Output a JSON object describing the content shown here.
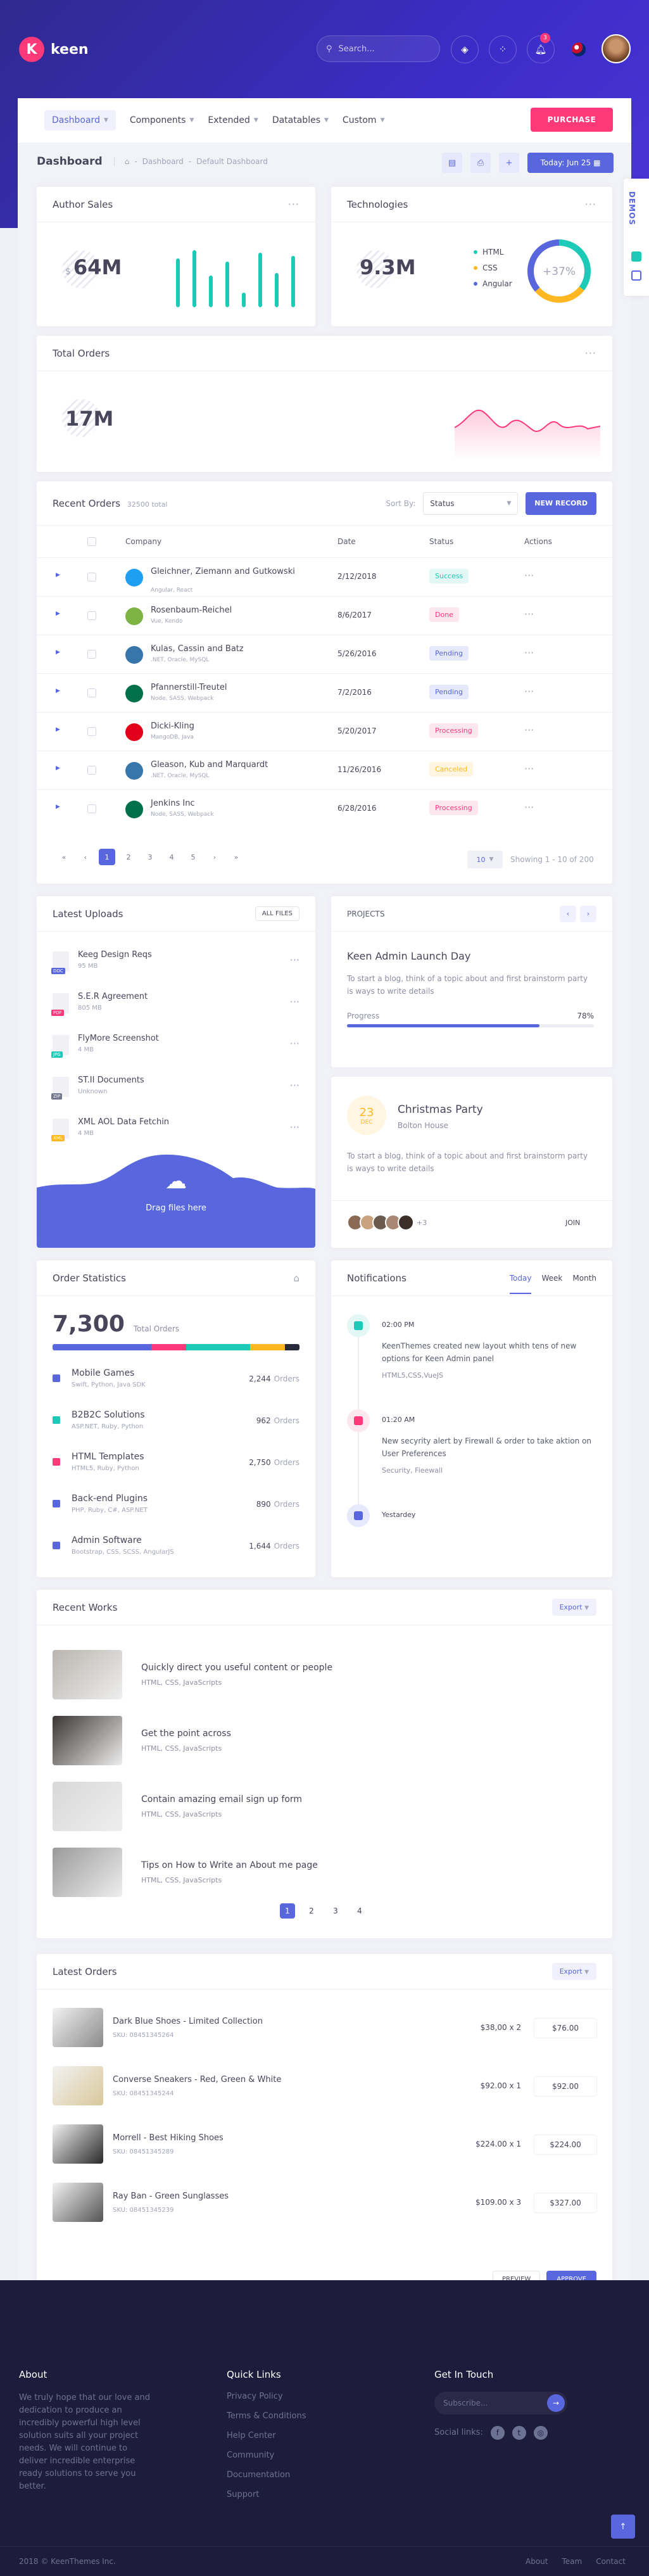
{
  "brand": {
    "name": "keen",
    "letter": "K"
  },
  "header": {
    "search_placeholder": "Search...",
    "notif_count": "3"
  },
  "menu": {
    "items": [
      "Dashboard",
      "Components",
      "Extended",
      "Datatables",
      "Custom"
    ],
    "purchase": "PURCHASE"
  },
  "subheader": {
    "title": "Dashboard",
    "crumbs": [
      "Dashboard",
      "Default Dashboard"
    ],
    "today": "Today: Jun 25"
  },
  "demos": "DEMOS",
  "author_sales": {
    "title": "Author Sales",
    "currency": "$",
    "value": "64M",
    "bars": [
      0.85,
      1.0,
      0.55,
      0.8,
      0.25,
      0.95,
      0.6,
      0.9
    ]
  },
  "technologies": {
    "title": "Technologies",
    "value": "9.3M",
    "legend": [
      {
        "label": "HTML",
        "color": "#1dc9b7"
      },
      {
        "label": "CSS",
        "color": "#ffb822"
      },
      {
        "label": "Angular",
        "color": "#5867dd"
      }
    ],
    "center": "+37%"
  },
  "total_orders": {
    "title": "Total Orders",
    "value": "17M"
  },
  "recent_orders": {
    "title": "Recent Orders",
    "total": "32500 total",
    "sort_label": "Sort By:",
    "sort_value": "Status",
    "new_record": "NEW RECORD",
    "headers": [
      "Company",
      "Date",
      "Status",
      "Actions"
    ],
    "rows": [
      {
        "company": "Gleichner, Ziemann and Gutkowski",
        "tech": "Angular, React",
        "date": "2/12/2018",
        "status": "Success",
        "kind": "success",
        "logo": "#1e9ff2"
      },
      {
        "company": "Rosenbaum-Reichel",
        "tech": "Vue, Kendo",
        "date": "8/6/2017",
        "status": "Done",
        "kind": "danger",
        "logo": "#7cb342"
      },
      {
        "company": "Kulas, Cassin and Batz",
        "tech": ".NET, Oracle, MySQL",
        "date": "5/26/2016",
        "status": "Pending",
        "kind": "info",
        "logo": "#3776ab"
      },
      {
        "company": "Pfannerstill-Treutel",
        "tech": "Node, SASS, Webpack",
        "date": "7/2/2016",
        "status": "Pending",
        "kind": "info",
        "logo": "#00704a"
      },
      {
        "company": "Dicki-Kling",
        "tech": "MangoDB, Java",
        "date": "5/20/2017",
        "status": "Processing",
        "kind": "danger",
        "logo": "#e3001b"
      },
      {
        "company": "Gleason, Kub and Marquardt",
        "tech": ".NET, Oracle, MySQL",
        "date": "11/26/2016",
        "status": "Canceled",
        "kind": "warning",
        "logo": "#3776ab"
      },
      {
        "company": "Jenkins Inc",
        "tech": "Node, SASS, Webpack",
        "date": "6/28/2016",
        "status": "Processing",
        "kind": "danger",
        "logo": "#00704a"
      }
    ],
    "pages": [
      "1",
      "2",
      "3",
      "4",
      "5"
    ],
    "per_page": "10",
    "showing": "Showing 1 - 10 of 200"
  },
  "uploads": {
    "title": "Latest Uploads",
    "all_files": "ALL FILES",
    "files": [
      {
        "name": "Keeg Design Reqs",
        "size": "95 MB",
        "ext": "DOC",
        "color": "#5867dd"
      },
      {
        "name": "S.E.R Agreement",
        "size": "805 MB",
        "ext": "PDF",
        "color": "#fd397a"
      },
      {
        "name": "FlyMore Screenshot",
        "size": "4 MB",
        "ext": "JPG",
        "color": "#1dc9b7"
      },
      {
        "name": "ST.II Documents",
        "size": "Unknown",
        "ext": "ZIP",
        "color": "#74788d"
      },
      {
        "name": "XML AOL Data Fetchin",
        "size": "4 MB",
        "ext": "XML",
        "color": "#ffb822"
      }
    ],
    "drop": "Drag files here"
  },
  "projects": {
    "label": "PROJECTS",
    "title": "Keen Admin Launch Day",
    "text": "To start a blog, think of a topic about and first brainstorm party is ways to write details",
    "progress_label": "Progress",
    "progress_text": "78%",
    "progress": 0.78
  },
  "party": {
    "day": "23",
    "month": "DEC",
    "title": "Christmas Party",
    "place": "Bolton House",
    "text": "To start a blog, think of a topic about and first brainstorm party is ways to write details",
    "more": "+3",
    "join": "JOIN"
  },
  "order_stats": {
    "title": "Order Statistics",
    "value": "7,300",
    "caption": "Total Orders",
    "segments": [
      {
        "w": 0.4,
        "c": "#5867dd"
      },
      {
        "w": 0.14,
        "c": "#fd397a"
      },
      {
        "w": 0.26,
        "c": "#1dc9b7"
      },
      {
        "w": 0.14,
        "c": "#ffb822"
      },
      {
        "w": 0.06,
        "c": "#282a3c"
      }
    ],
    "items": [
      {
        "name": "Mobile Games",
        "sub": "Swift, Python, Java SDK",
        "count": "2,244",
        "unit": "Orders",
        "color": "#5867dd"
      },
      {
        "name": "B2B2C Solutions",
        "sub": "ASP.NET, Ruby, Python",
        "count": "962",
        "unit": "Orders",
        "color": "#1dc9b7"
      },
      {
        "name": "HTML Templates",
        "sub": "HTML5, Ruby, Python",
        "count": "2,750",
        "unit": "Orders",
        "color": "#fd397a"
      },
      {
        "name": "Back-end Plugins",
        "sub": "PHP, Ruby, C#, ASP.NET",
        "count": "890",
        "unit": "Orders",
        "color": "#5867dd"
      },
      {
        "name": "Admin Software",
        "sub": "Bootstrap, CSS, SCSS, AngularJS",
        "count": "1,644",
        "unit": "Orders",
        "color": "#5867dd"
      }
    ]
  },
  "notifications": {
    "title": "Notifications",
    "tabs": [
      "Today",
      "Week",
      "Month"
    ],
    "items": [
      {
        "time": "02:00 PM",
        "text": "KeenThemes created new layout whith tens of new options for Keen Admin panel",
        "tag": "HTML5,CSS,VueJS",
        "color": "#1dc9b7",
        "bg": "#e3f7f4"
      },
      {
        "time": "01:20 AM",
        "text": "New secyrity alert by Firewall & order to take aktion on User Preferences",
        "tag": "Security, Fieewall",
        "color": "#fd397a",
        "bg": "#fde7ef"
      },
      {
        "time": "Yestardey",
        "text": "",
        "tag": "",
        "color": "#5867dd",
        "bg": "#e6e8fb"
      }
    ]
  },
  "recent_works": {
    "title": "Recent Works",
    "export": "Export",
    "items": [
      {
        "title": "Quickly direct you useful content or people",
        "tags": "HTML, CSS, JavaScripts"
      },
      {
        "title": "Get the point across",
        "tags": "HTML, CSS, JavaScripts"
      },
      {
        "title": "Contain amazing email sign up form",
        "tags": "HTML, CSS, JavaScripts"
      },
      {
        "title": "Tips on How to Write an About me page",
        "tags": "HTML, CSS, JavaScripts"
      }
    ],
    "pages": [
      "1",
      "2",
      "3",
      "4"
    ]
  },
  "latest_orders": {
    "title": "Latest Orders",
    "export": "Export",
    "items": [
      {
        "name": "Dark Blue Shoes - Limited Collection",
        "sku": "SKU: 08451345264",
        "qty": "$38,00 x 2",
        "total": "$76.00"
      },
      {
        "name": "Converse Sneakers - Red, Green & White",
        "sku": "SKU: 08451345244",
        "qty": "$92.00 x 1",
        "total": "$92.00"
      },
      {
        "name": "Morrell - Best Hiking Shoes",
        "sku": "SKU: 08451345289",
        "qty": "$224.00 x 1",
        "total": "$224.00"
      },
      {
        "name": "Ray Ban - Green Sunglasses",
        "sku": "SKU: 08451345239",
        "qty": "$109.00 x 3",
        "total": "$327.00"
      }
    ],
    "preview": "PREVIEW",
    "approve": "APPROVE"
  },
  "footer": {
    "about_title": "About",
    "about_text": "We truly hope that our love and dedication to produce an incredibly powerful high level solution suits all your project needs. We will continue to deliver incredible enterprise ready solutions to serve you better.",
    "links_title": "Quick Links",
    "links": [
      "Privacy Policy",
      "Terms & Conditions",
      "Help Center",
      "Community",
      "Documentation",
      "Support"
    ],
    "touch_title": "Get In Touch",
    "subscribe_placeholder": "Subscribe...",
    "social_label": "Social links:",
    "copyright": "2018 © KeenThemes Inc.",
    "bottom_links": [
      "About",
      "Team",
      "Contact"
    ]
  }
}
